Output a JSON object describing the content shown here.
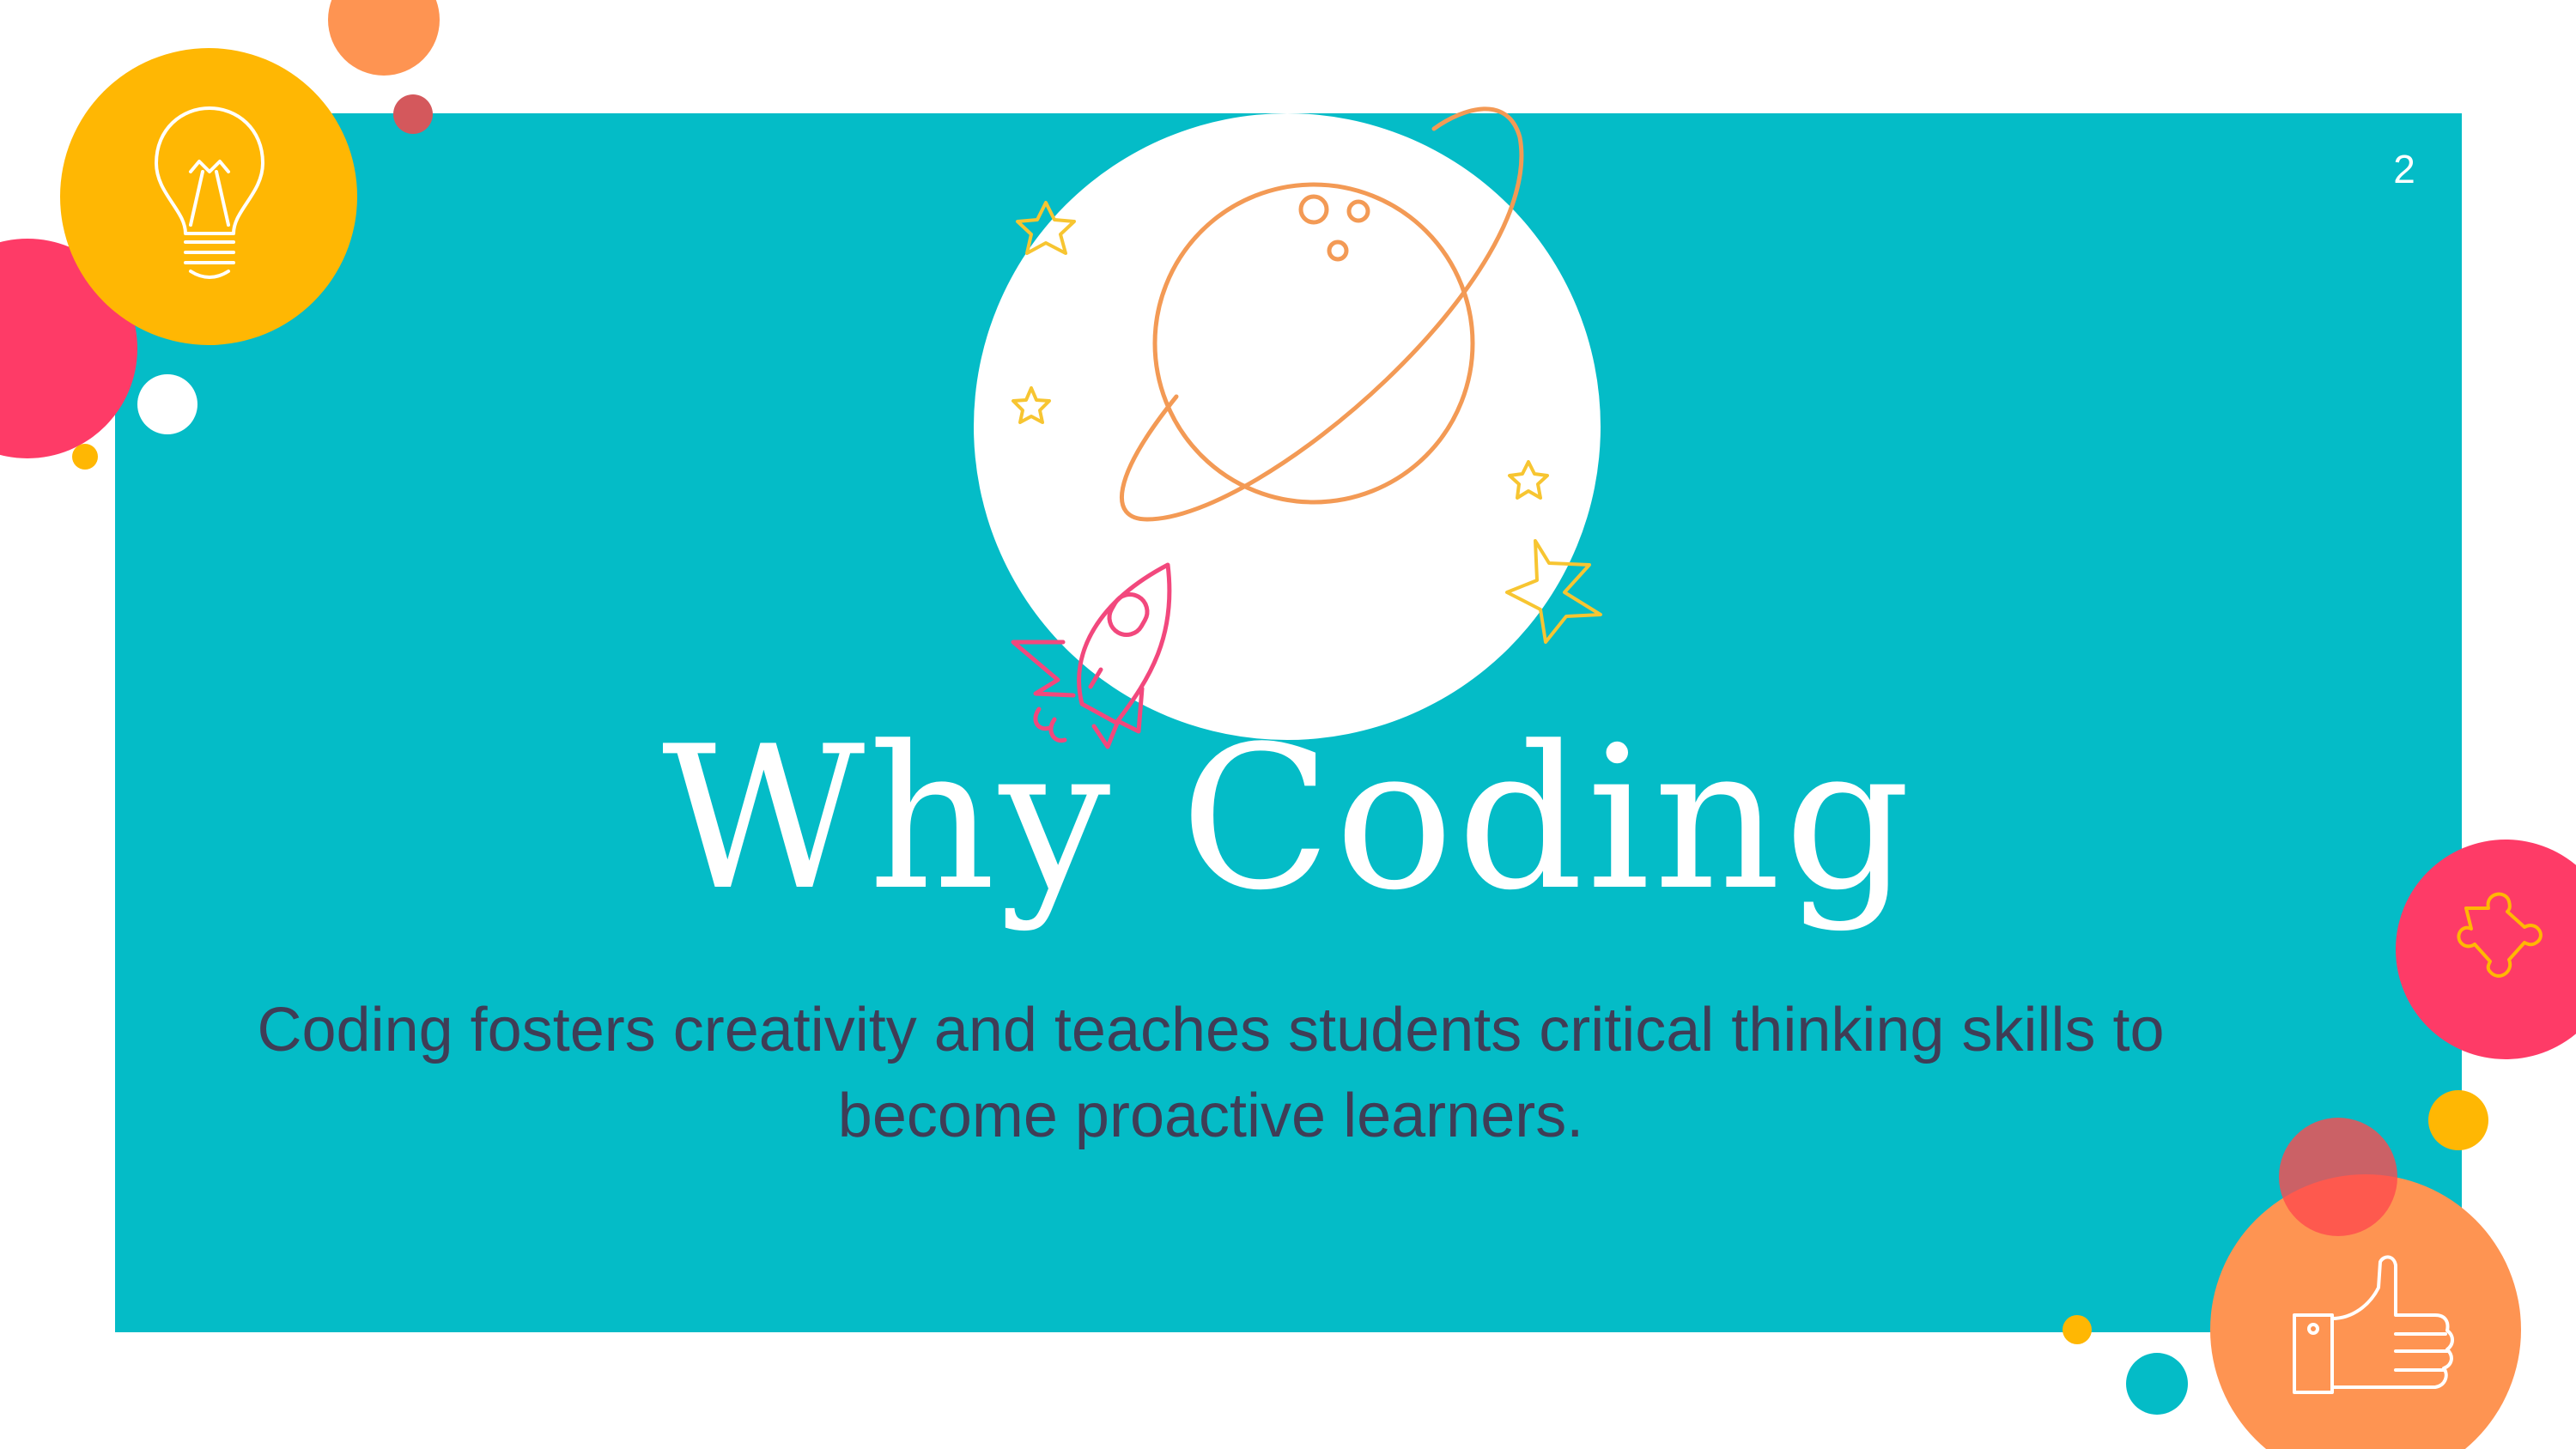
{
  "slide": {
    "page_number": "2",
    "title": "Why Coding",
    "subtitle": "Coding fosters creativity and teaches students critical thinking skills to become proactive learners."
  },
  "icons": {
    "top_left": "lightbulb-icon",
    "center": "planet-icon",
    "rocket": "rocket-icon",
    "stars": "star-icon",
    "right": "puzzle-piece-icon",
    "bottom_right": "thumbs-up-icon"
  },
  "colors": {
    "background": "#FFFFFF",
    "panel": "#04BCC7",
    "yellow": "#FFB703",
    "orange": "#FE9452",
    "pink": "#FE3B67",
    "muted_red": "#D4585C",
    "title_text": "#FFFFFF",
    "body_text": "#3F3D56"
  }
}
